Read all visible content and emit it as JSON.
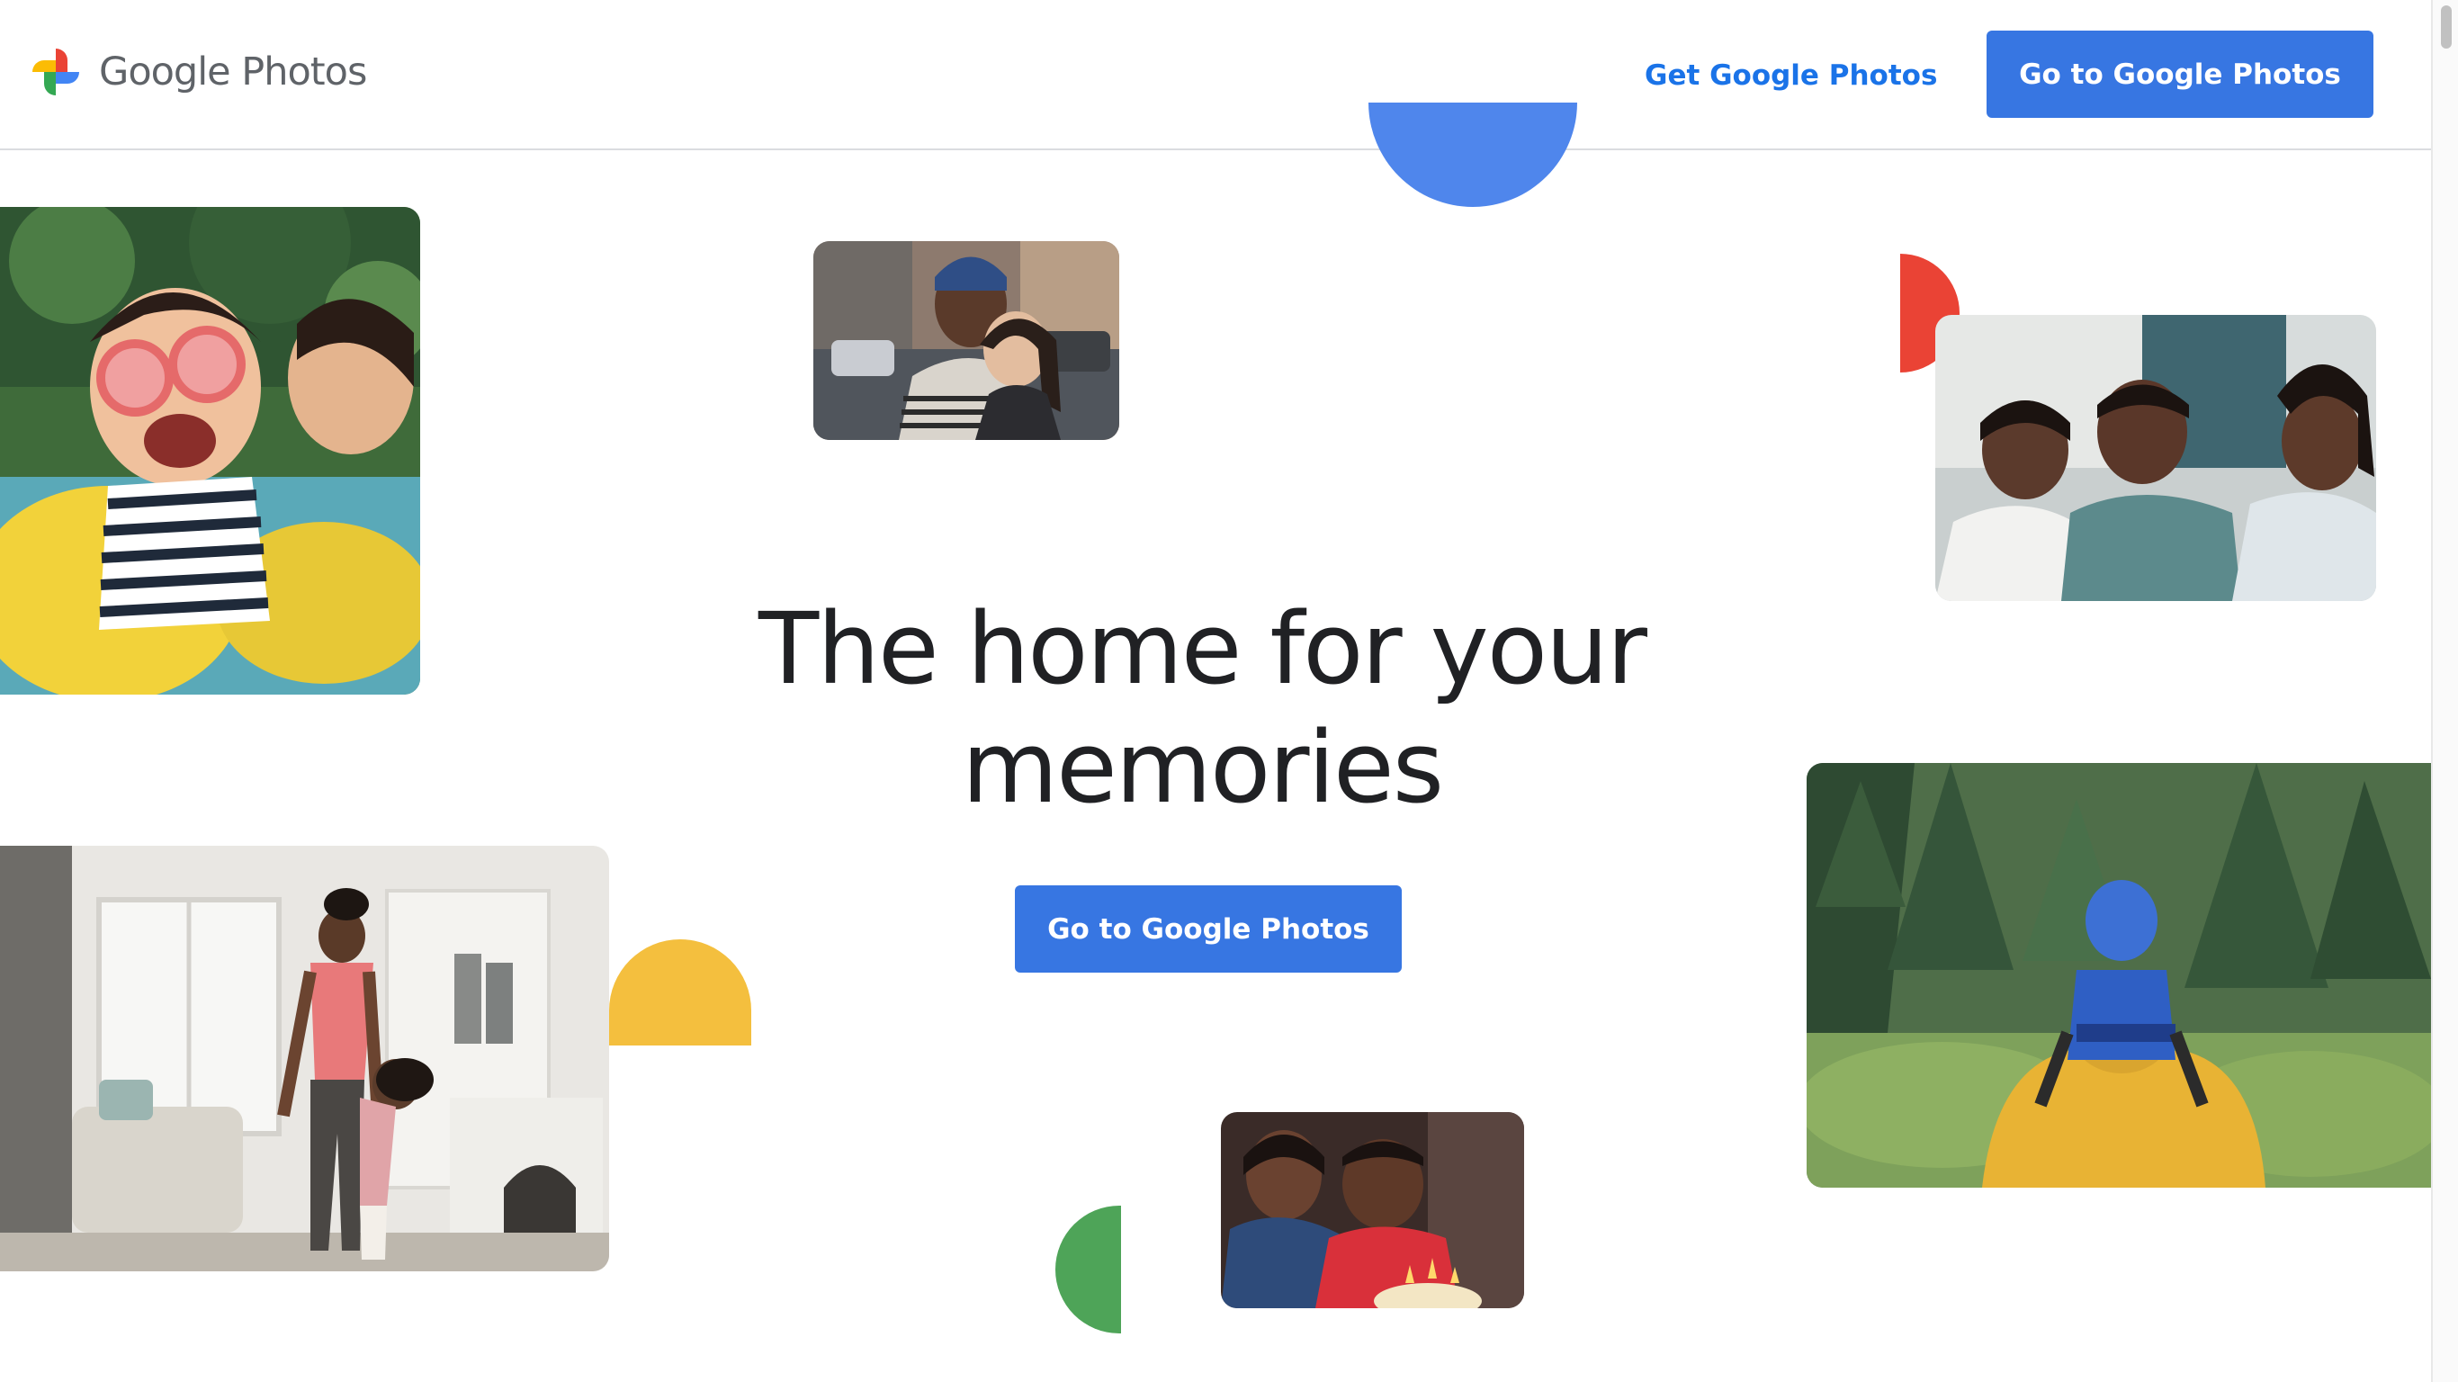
{
  "header": {
    "brand_name": "Google Photos",
    "get_link_label": "Get Google Photos",
    "go_button_label": "Go to Google Photos"
  },
  "hero": {
    "headline_line1": "The home for your",
    "headline_line2": "memories",
    "cta_label": "Go to Google Photos"
  },
  "colors": {
    "brand_blue": "#3776e2",
    "link_blue": "#1a73e8",
    "google_blue": "#4f86ec",
    "google_red": "#ea4335",
    "google_yellow": "#f4bf3e",
    "google_green": "#4ea458",
    "headline_text": "#202124"
  },
  "icons": {
    "logo": "google-photos-pinwheel-icon"
  }
}
